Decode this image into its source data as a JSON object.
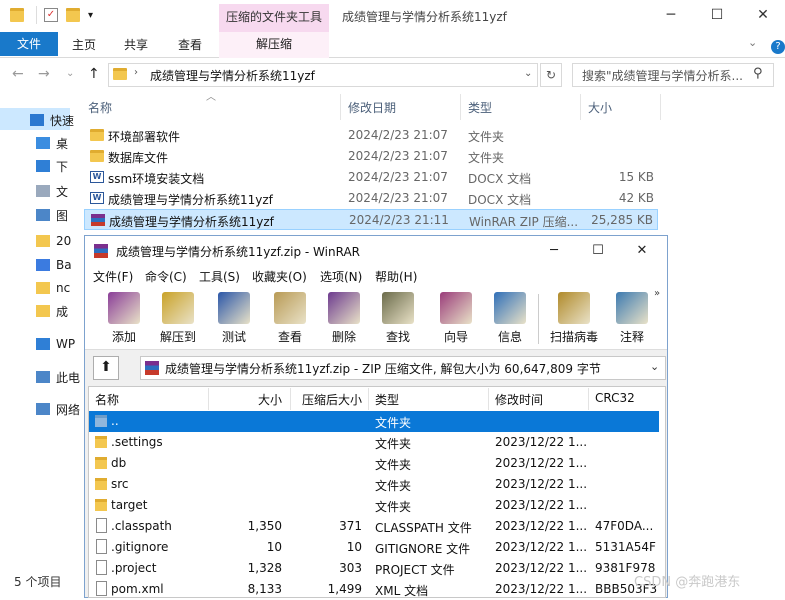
{
  "explorer": {
    "context_tab_title": "压缩的文件夹工具",
    "window_title": "成绩管理与学情分析系统11yzf",
    "ribbon_tabs": [
      "文件",
      "主页",
      "共享",
      "查看",
      "解压缩"
    ],
    "help_glyph": "?",
    "address": "成绩管理与学情分析系统11yzf",
    "search_placeholder": "搜索\"成绩管理与学情分析系...",
    "sidebar": [
      {
        "label": "快速",
        "icon": "star-icon"
      },
      {
        "label": "桌",
        "icon": "desktop-icon"
      },
      {
        "label": "下",
        "icon": "download-icon"
      },
      {
        "label": "文",
        "icon": "document-icon"
      },
      {
        "label": "图",
        "icon": "picture-icon"
      },
      {
        "label": "20",
        "icon": "folder-icon"
      },
      {
        "label": "Ba",
        "icon": "baidu-icon"
      },
      {
        "label": "nc",
        "icon": "folder-icon"
      },
      {
        "label": "成",
        "icon": "folder-icon"
      },
      {
        "label": "WP",
        "icon": "cloud-icon"
      },
      {
        "label": "此电",
        "icon": "computer-icon"
      },
      {
        "label": "网络",
        "icon": "network-icon"
      }
    ],
    "columns": {
      "name": "名称",
      "date": "修改日期",
      "type": "类型",
      "size": "大小"
    },
    "files": [
      {
        "name": "环境部署软件",
        "date": "2024/2/23 21:07",
        "type": "文件夹",
        "size": "",
        "icon": "folder-icon"
      },
      {
        "name": "数据库文件",
        "date": "2024/2/23 21:07",
        "type": "文件夹",
        "size": "",
        "icon": "folder-icon"
      },
      {
        "name": "ssm环境安装文档",
        "date": "2024/2/23 21:07",
        "type": "DOCX 文档",
        "size": "15 KB",
        "icon": "word-icon"
      },
      {
        "name": "成绩管理与学情分析系统11yzf",
        "date": "2024/2/23 21:07",
        "type": "DOCX 文档",
        "size": "42 KB",
        "icon": "word-icon"
      },
      {
        "name": "成绩管理与学情分析系统11yzf",
        "date": "2024/2/23 21:11",
        "type": "WinRAR ZIP 压缩...",
        "size": "25,285 KB",
        "icon": "winrar-icon"
      }
    ],
    "status": "5 个项目"
  },
  "winrar": {
    "title": "成绩管理与学情分析系统11yzf.zip - WinRAR",
    "menu": [
      "文件(F)",
      "命令(C)",
      "工具(S)",
      "收藏夹(O)",
      "选项(N)",
      "帮助(H)"
    ],
    "tools": [
      {
        "label": "添加",
        "icon": "add-archive-icon",
        "color": "#8a3d98"
      },
      {
        "label": "解压到",
        "icon": "extract-to-icon",
        "color": "#c9a227"
      },
      {
        "label": "测试",
        "icon": "test-icon",
        "color": "#2a56a8"
      },
      {
        "label": "查看",
        "icon": "view-icon",
        "color": "#b89a55"
      },
      {
        "label": "删除",
        "icon": "delete-icon",
        "color": "#6c3a8e"
      },
      {
        "label": "查找",
        "icon": "find-icon",
        "color": "#6b6b4a"
      },
      {
        "label": "向导",
        "icon": "wizard-icon",
        "color": "#9a3c7a"
      },
      {
        "label": "信息",
        "icon": "info-icon",
        "color": "#2f6fb8"
      },
      {
        "label": "扫描病毒",
        "icon": "virus-scan-icon",
        "color": "#b08a2a"
      },
      {
        "label": "注释",
        "icon": "comment-icon",
        "color": "#3c7ab0"
      }
    ],
    "path": "成绩管理与学情分析系统11yzf.zip - ZIP 压缩文件, 解包大小为 60,647,809 字节",
    "columns": {
      "name": "名称",
      "size": "大小",
      "packed": "压缩后大小",
      "type": "类型",
      "modified": "修改时间",
      "crc": "CRC32"
    },
    "rows": [
      {
        "name": "..",
        "size": "",
        "packed": "",
        "type": "文件夹",
        "modified": "",
        "crc": "",
        "kind": "folder"
      },
      {
        "name": ".settings",
        "size": "",
        "packed": "",
        "type": "文件夹",
        "modified": "2023/12/22 1...",
        "crc": "",
        "kind": "folder"
      },
      {
        "name": "db",
        "size": "",
        "packed": "",
        "type": "文件夹",
        "modified": "2023/12/22 1...",
        "crc": "",
        "kind": "folder"
      },
      {
        "name": "src",
        "size": "",
        "packed": "",
        "type": "文件夹",
        "modified": "2023/12/22 1...",
        "crc": "",
        "kind": "folder"
      },
      {
        "name": "target",
        "size": "",
        "packed": "",
        "type": "文件夹",
        "modified": "2023/12/22 1...",
        "crc": "",
        "kind": "folder"
      },
      {
        "name": ".classpath",
        "size": "1,350",
        "packed": "371",
        "type": "CLASSPATH 文件",
        "modified": "2023/12/22 1...",
        "crc": "47F0DA...",
        "kind": "file"
      },
      {
        "name": ".gitignore",
        "size": "10",
        "packed": "10",
        "type": "GITIGNORE 文件",
        "modified": "2023/12/22 1...",
        "crc": "5131A54F",
        "kind": "file"
      },
      {
        "name": ".project",
        "size": "1,328",
        "packed": "303",
        "type": "PROJECT 文件",
        "modified": "2023/12/22 1...",
        "crc": "9381F978",
        "kind": "file"
      },
      {
        "name": "pom.xml",
        "size": "8,133",
        "packed": "1,499",
        "type": "XML 文档",
        "modified": "2023/12/22 1...",
        "crc": "BBB503F3",
        "kind": "file"
      }
    ]
  },
  "watermark": "CSDN @奔跑港东"
}
